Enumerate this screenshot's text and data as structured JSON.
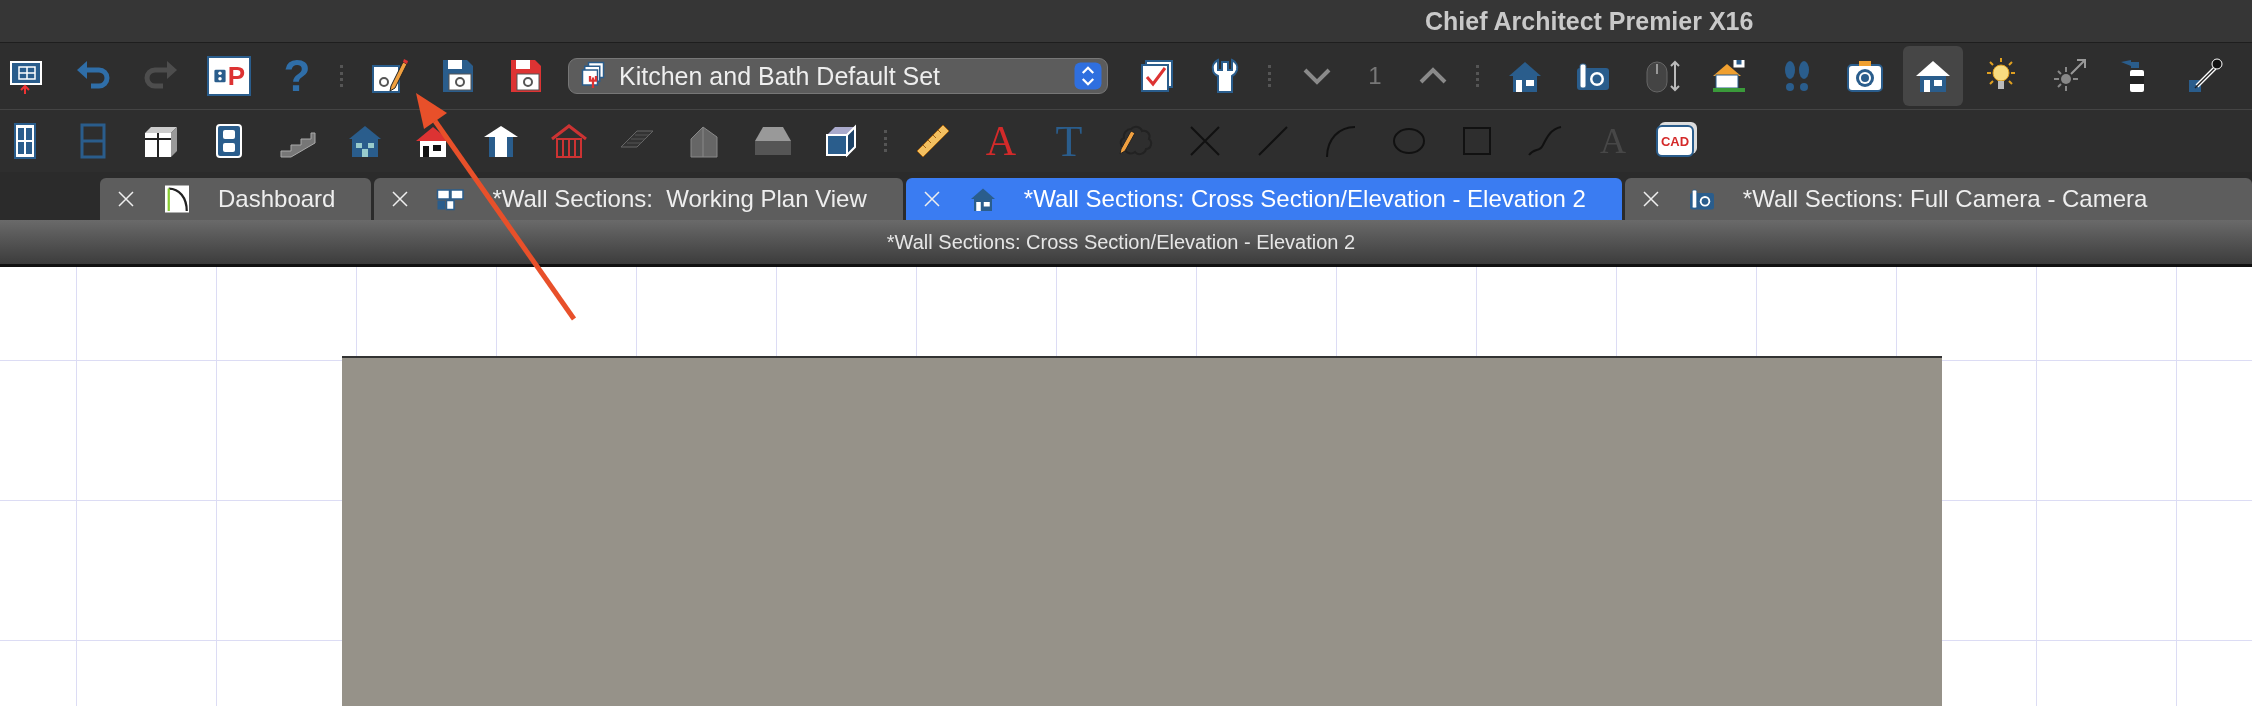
{
  "window": {
    "title": "Chief Architect Premier X16"
  },
  "main_toolbar": {
    "items": [
      {
        "kind": "button",
        "selected": false,
        "disabled": false
      },
      {
        "kind": "button",
        "selected": false,
        "disabled": false
      },
      {
        "kind": "button",
        "selected": false,
        "disabled": true
      },
      {
        "kind": "glyph",
        "text": "P",
        "selected": false,
        "disabled": false
      },
      {
        "kind": "glyph",
        "text": "?",
        "selected": false,
        "disabled": false
      },
      {
        "kind": "separator"
      },
      {
        "kind": "button",
        "selected": false,
        "disabled": false
      },
      {
        "kind": "button",
        "selected": false,
        "disabled": false
      },
      {
        "kind": "button",
        "selected": false,
        "disabled": false
      },
      {
        "kind": "dropdown",
        "value": "Kitchen and Bath Default Set"
      },
      {
        "kind": "button",
        "selected": false,
        "disabled": false
      },
      {
        "kind": "button",
        "selected": false,
        "disabled": false
      },
      {
        "kind": "separator"
      },
      {
        "kind": "button",
        "selected": false,
        "disabled": false
      },
      {
        "kind": "floor",
        "text": "1"
      },
      {
        "kind": "button",
        "selected": false,
        "disabled": false
      },
      {
        "kind": "separator"
      },
      {
        "kind": "button",
        "selected": false,
        "disabled": false
      },
      {
        "kind": "button",
        "selected": false,
        "disabled": false
      },
      {
        "kind": "button",
        "selected": false,
        "disabled": false
      },
      {
        "kind": "button",
        "selected": false,
        "disabled": false
      },
      {
        "kind": "button",
        "selected": false,
        "disabled": false
      },
      {
        "kind": "button",
        "selected": false,
        "disabled": false
      },
      {
        "kind": "button",
        "selected": true,
        "disabled": false
      },
      {
        "kind": "button",
        "selected": false,
        "disabled": false
      },
      {
        "kind": "button",
        "selected": false,
        "disabled": false
      },
      {
        "kind": "button",
        "selected": false,
        "disabled": false
      },
      {
        "kind": "button",
        "selected": false,
        "disabled": false
      }
    ]
  },
  "drawing_toolbar": {
    "items": [
      {
        "kind": "button",
        "selected": false,
        "disabled": false
      },
      {
        "kind": "button",
        "selected": false,
        "disabled": false
      },
      {
        "kind": "button",
        "selected": false,
        "disabled": false
      },
      {
        "kind": "button",
        "selected": false,
        "disabled": false
      },
      {
        "kind": "button",
        "selected": false,
        "disabled": false
      },
      {
        "kind": "button",
        "selected": false,
        "disabled": false
      },
      {
        "kind": "button",
        "selected": false,
        "disabled": false
      },
      {
        "kind": "button",
        "selected": false,
        "disabled": false
      },
      {
        "kind": "button",
        "selected": false,
        "disabled": false
      },
      {
        "kind": "button",
        "selected": false,
        "disabled": false
      },
      {
        "kind": "button",
        "selected": false,
        "disabled": false
      },
      {
        "kind": "button",
        "selected": false,
        "disabled": false
      },
      {
        "kind": "button",
        "selected": false,
        "disabled": false
      },
      {
        "kind": "separator"
      },
      {
        "kind": "button",
        "selected": false,
        "disabled": false
      },
      {
        "kind": "glyph",
        "text": "A",
        "selected": false,
        "disabled": false
      },
      {
        "kind": "glyph",
        "text": "T",
        "selected": false,
        "disabled": false
      },
      {
        "kind": "button",
        "selected": false,
        "disabled": false
      },
      {
        "kind": "button",
        "selected": false,
        "disabled": false
      },
      {
        "kind": "button",
        "selected": false,
        "disabled": false
      },
      {
        "kind": "button",
        "selected": false,
        "disabled": false
      },
      {
        "kind": "button",
        "selected": false,
        "disabled": false
      },
      {
        "kind": "button",
        "selected": false,
        "disabled": false
      },
      {
        "kind": "button",
        "selected": false,
        "disabled": false
      },
      {
        "kind": "glyph",
        "text": "A",
        "selected": false,
        "disabled": true
      },
      {
        "kind": "glyph",
        "text": "CAD",
        "selected": false,
        "disabled": false
      }
    ]
  },
  "tabs": [
    {
      "label": "Dashboard",
      "selected": false
    },
    {
      "label": "*Wall Sections:  Working Plan View",
      "selected": false
    },
    {
      "label": "*Wall Sections: Cross Section/Elevation - Elevation 2",
      "selected": true
    },
    {
      "label": "*Wall Sections: Full Camera - Camera",
      "selected": false
    }
  ],
  "view_title": "*Wall Sections: Cross Section/Elevation - Elevation 2"
}
